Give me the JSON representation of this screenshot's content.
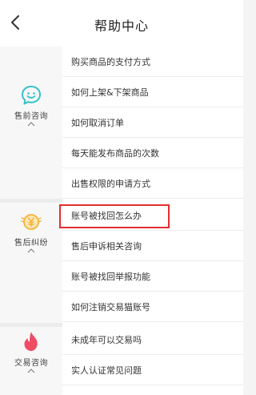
{
  "header": {
    "title": "帮助中心"
  },
  "categories": [
    {
      "label": "售前咨询",
      "color": "#32c3c8",
      "icon": "chat-smile-icon"
    },
    {
      "label": "售后纠纷",
      "color": "#f3b23a",
      "icon": "yen-coin-icon"
    },
    {
      "label": "交易咨询",
      "color": "#ef4b63",
      "icon": "flame-icon"
    }
  ],
  "items": [
    "购买商品的支付方式",
    "如何上架&下架商品",
    "如何取消订单",
    "每天能发布商品的次数",
    "出售权限的申请方式",
    "账号被找回怎么办",
    "售后申诉相关咨询",
    "账号被找回举报功能",
    "如何注销交易猫账号",
    "未成年可以交易吗",
    "实人认证常见问题"
  ],
  "highlight_color": "#e0302f"
}
